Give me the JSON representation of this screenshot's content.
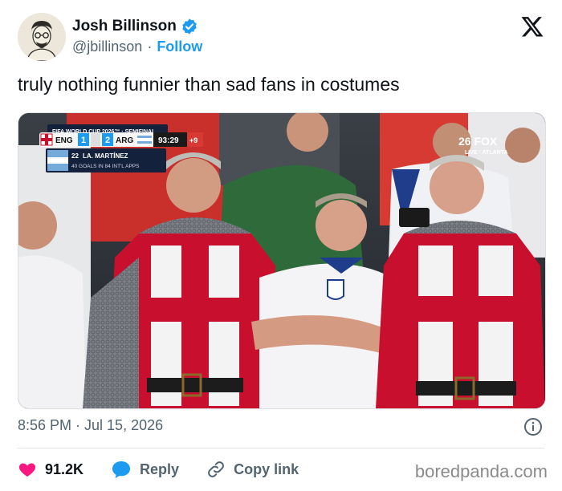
{
  "author": {
    "name": "Josh Billinson",
    "handle": "@jbillinson",
    "separator": "·",
    "follow_label": "Follow",
    "verified": true,
    "avatar_icon": "avatar-portrait"
  },
  "tweet": {
    "text": "truly nothing funnier than sad fans in costumes",
    "timestamp": "8:56 PM · Jul 15, 2026"
  },
  "scorebug": {
    "competition": "FIFA WORLD CUP 2026™ · SEMIFINAL",
    "team1": "ENG",
    "score1": "1",
    "team2": "ARG",
    "score2": "2",
    "clock": "93:29",
    "added_time": "+9",
    "player_number": "22",
    "player_name": "LA. MARTÍNEZ",
    "player_stat": "40 GOALS IN 84 INT'L APPS"
  },
  "broadcaster": {
    "logo": "26 FOX",
    "location": "LIVE · ATLANTA"
  },
  "actions": {
    "like_count": "91.2K",
    "reply_label": "Reply",
    "copy_label": "Copy link"
  },
  "watermark": "boredpanda.com",
  "colors": {
    "like": "#f91880",
    "reply": "#1d9bf0",
    "link": "#1d9bf0",
    "muted": "#536471",
    "verified": "#1d9bf0",
    "cross_red": "#c8102e"
  }
}
